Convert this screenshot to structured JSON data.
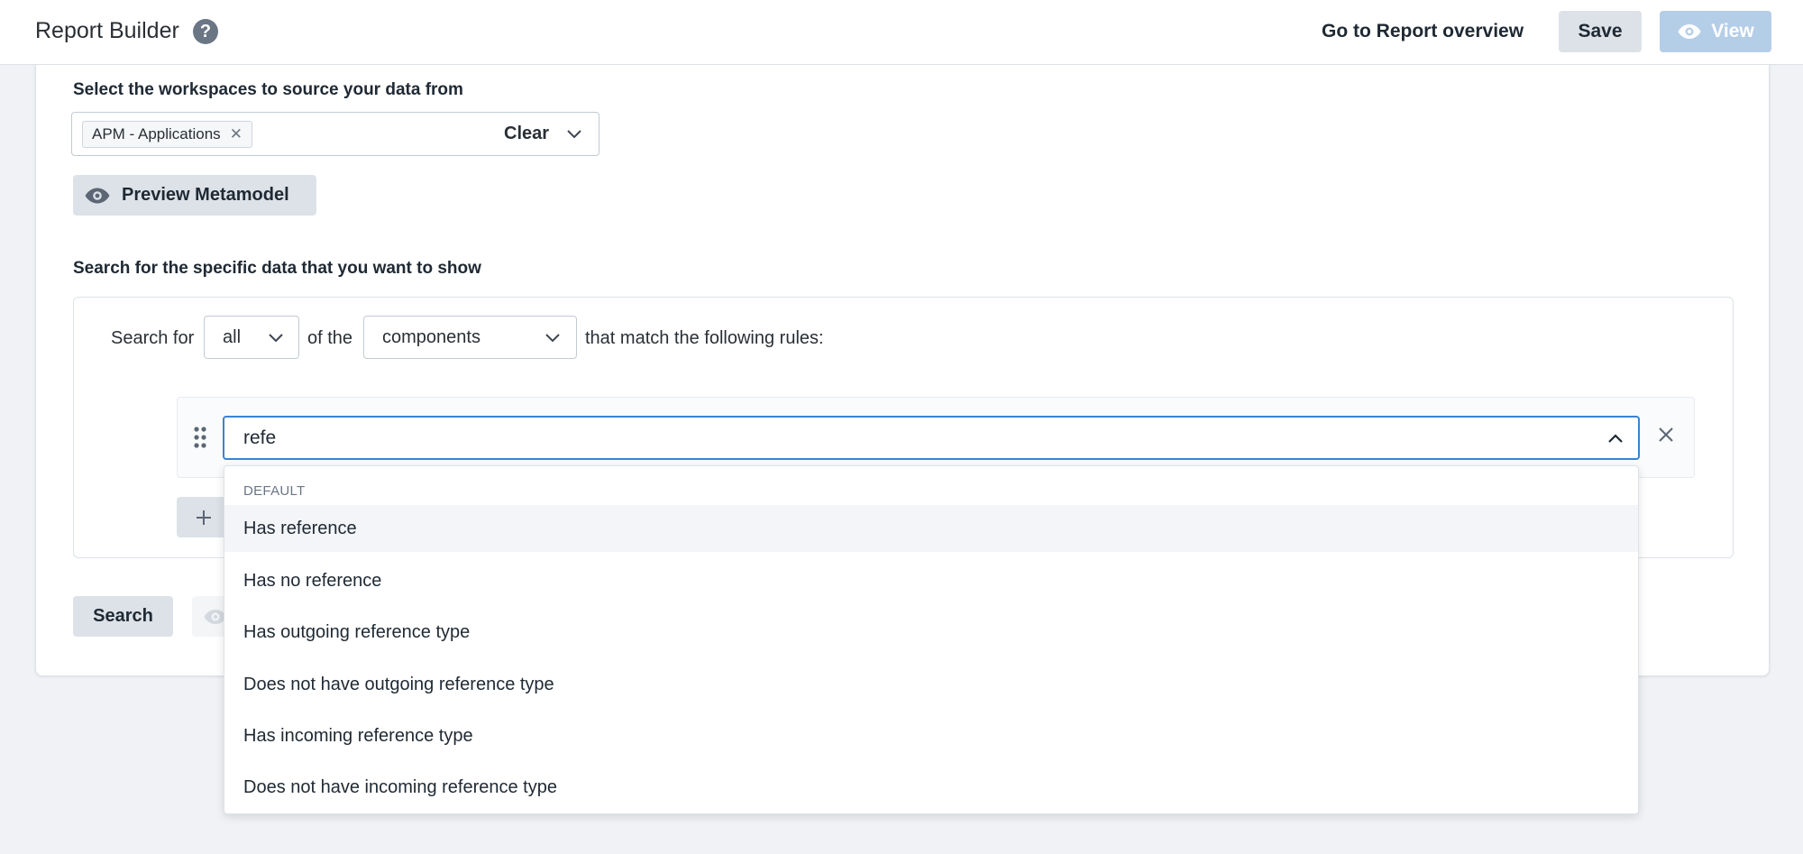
{
  "header": {
    "title": "Report Builder",
    "help_icon": "question-circle-icon",
    "go_overview": "Go to Report overview",
    "save": "Save",
    "view": "View"
  },
  "workspaces": {
    "label": "Select the workspaces to source your data from",
    "chips": [
      "APM - Applications"
    ],
    "clear": "Clear",
    "preview_button": "Preview Metamodel"
  },
  "search": {
    "label": "Search for the specific data that you want to show",
    "prefix": "Search for",
    "quantifier": "all",
    "middle": "of the",
    "entity": "components",
    "suffix": "that match the following rules:",
    "rule_input_value": "refe",
    "search_button": "Search"
  },
  "dropdown": {
    "group": "DEFAULT",
    "options": [
      "Has reference",
      "Has no reference",
      "Has outgoing reference type",
      "Does not have outgoing reference type",
      "Has incoming reference type",
      "Does not have incoming reference type"
    ],
    "active_index": 0
  },
  "colors": {
    "accent": "#3a83d0",
    "view_button_disabled": "#b5cee8",
    "secondary_button": "#dde2e8"
  }
}
